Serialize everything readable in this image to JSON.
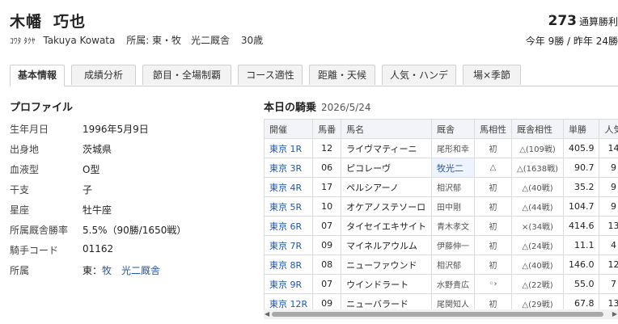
{
  "jockey": {
    "surname": "木幡",
    "given": "巧也",
    "kana": "ｺﾜﾀ ﾀｸﾔ",
    "romaji": "Takuya Kowata",
    "affiliation_line": "所属: 東・牧　光二厩舎",
    "age": "30歳",
    "total_wins": "273",
    "total_wins_label": "通算勝利",
    "year_stats": "今年 9勝 / 昨年 24勝"
  },
  "tabs": [
    "基本情報",
    "成績分析",
    "節目・全場制覇",
    "コース適性",
    "距離・天候",
    "人気・ハンデ",
    "場×季節"
  ],
  "profile": {
    "heading": "プロファイル",
    "rows": [
      {
        "k": "生年月日",
        "v": "1996年5月9日"
      },
      {
        "k": "出身地",
        "v": "茨城県"
      },
      {
        "k": "血液型",
        "v": "O型"
      },
      {
        "k": "干支",
        "v": "子"
      },
      {
        "k": "星座",
        "v": "牡牛座"
      },
      {
        "k": "所属厩舎勝率",
        "v": "5.5%（90勝/1650戦）"
      },
      {
        "k": "騎手コード",
        "v": "01162"
      }
    ],
    "aff_label": "所属",
    "aff_region": "東：",
    "aff_link1": "牧",
    "aff_link2": "光二厩舎"
  },
  "today": {
    "heading": "本日の騎乗",
    "date": "2026/5/24",
    "columns": [
      "開催",
      "馬番",
      "馬名",
      "厩舎",
      "馬相性",
      "厩舎相性",
      "単勝",
      "人気"
    ],
    "rows": [
      {
        "venue": "東京 1R",
        "num": "12",
        "horse": "ライヴマティーニ",
        "stable": "尾形和幸",
        "hcompat": "初",
        "scompat": "△(109戦)",
        "odds": "405.9",
        "pop": "14"
      },
      {
        "venue": "東京 3R",
        "num": "06",
        "horse": "ピコレーヴ",
        "stable": "牧光二",
        "hcompat": "△",
        "scompat": "△(1638戦)",
        "odds": "90.7",
        "pop": "9"
      },
      {
        "venue": "東京 4R",
        "num": "17",
        "horse": "ペルシアーノ",
        "stable": "相沢郁",
        "hcompat": "初",
        "scompat": "△(40戦)",
        "odds": "35.2",
        "pop": "9"
      },
      {
        "venue": "東京 5R",
        "num": "10",
        "horse": "オケアノステソーロ",
        "stable": "田中剛",
        "hcompat": "初",
        "scompat": "△(44戦)",
        "odds": "104.7",
        "pop": "9"
      },
      {
        "venue": "東京 6R",
        "num": "07",
        "horse": "タイセイエキサイト",
        "stable": "青木孝文",
        "hcompat": "初",
        "scompat": "×(34戦)",
        "odds": "414.6",
        "pop": "13"
      },
      {
        "venue": "東京 7R",
        "num": "09",
        "horse": "マイネルアウルム",
        "stable": "伊藤伸一",
        "hcompat": "初",
        "scompat": "△(24戦)",
        "odds": "11.1",
        "pop": "4"
      },
      {
        "venue": "東京 8R",
        "num": "08",
        "horse": "ニューファウンド",
        "stable": "相沢郁",
        "hcompat": "初",
        "scompat": "△(40戦)",
        "odds": "146.0",
        "pop": "12"
      },
      {
        "venue": "東京 9R",
        "num": "07",
        "horse": "ウインドラート",
        "stable": "水野貴広",
        "hcompat": "◦›",
        "scompat": "△(22戦)",
        "odds": "55.0",
        "pop": "7"
      },
      {
        "venue": "東京 12R",
        "num": "09",
        "horse": "ニューバラード",
        "stable": "尾関知人",
        "hcompat": "初",
        "scompat": "△(29戦)",
        "odds": "67.8",
        "pop": "13"
      }
    ]
  },
  "colors": {
    "link": "#2356a8",
    "bad": "#d33333",
    "header_bg": "#f2f4f8"
  }
}
